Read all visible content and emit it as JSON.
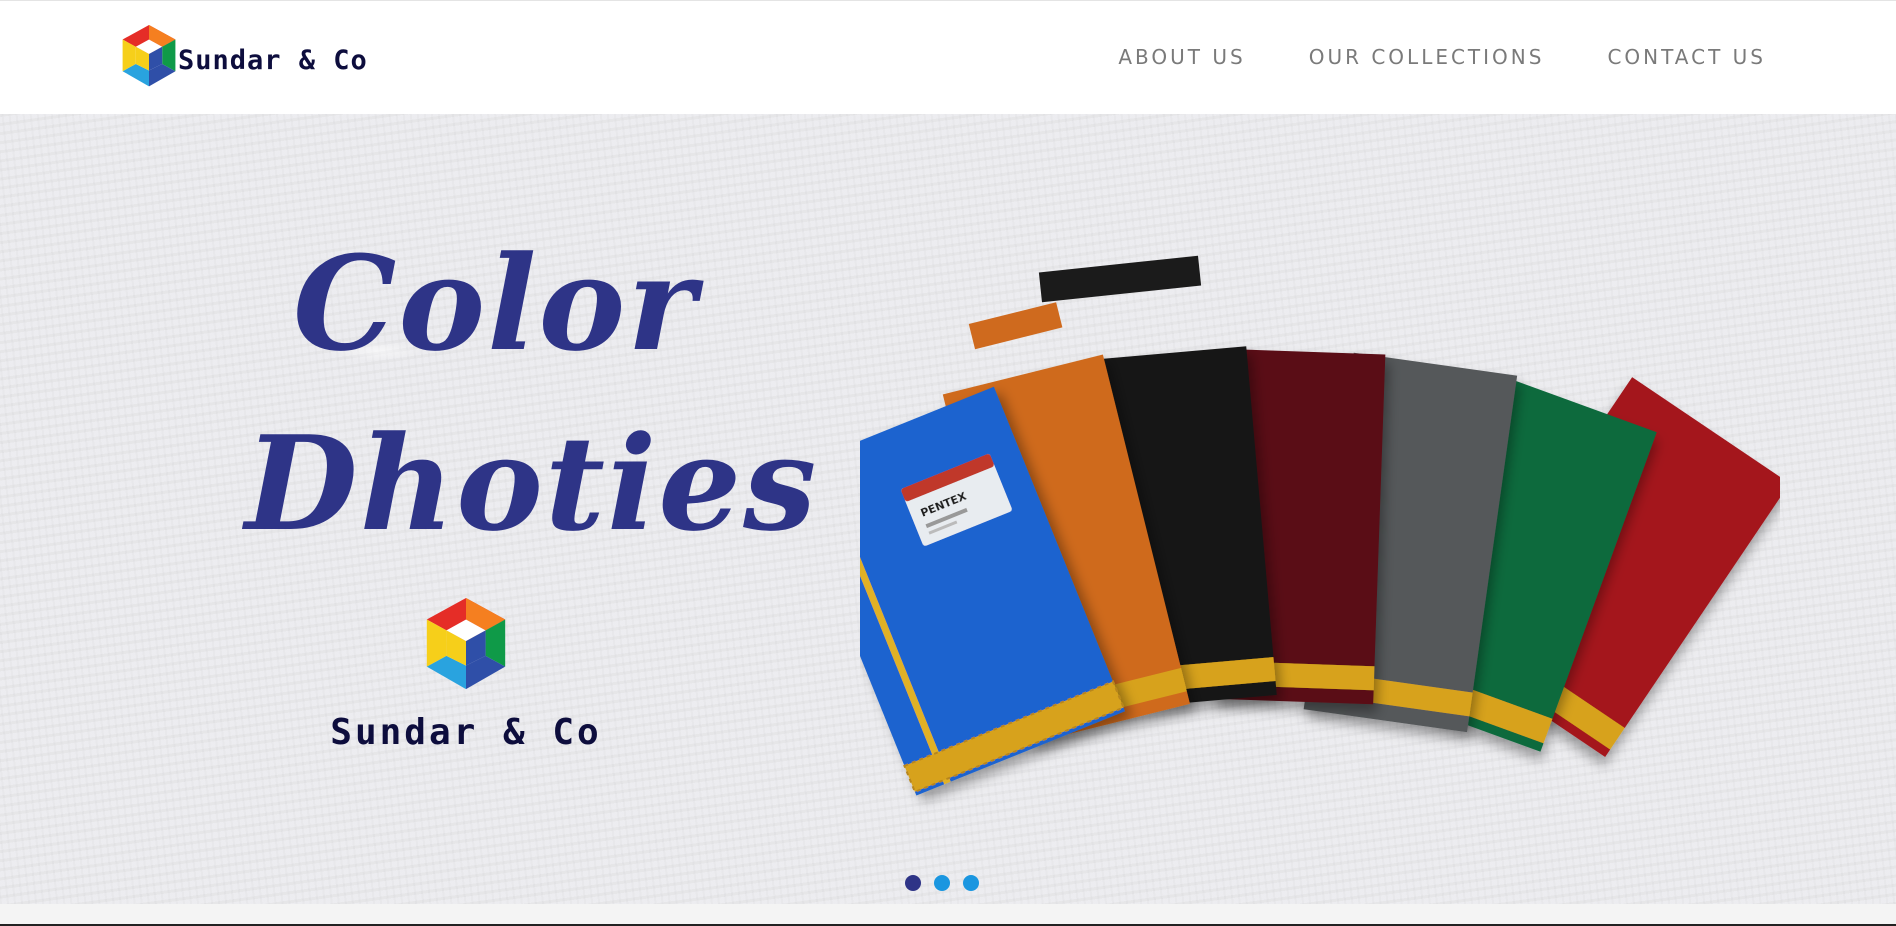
{
  "brand": {
    "name": "Sundar & Co",
    "logo_icon": "hexagon-cube-logo",
    "logo_colors": [
      "#e52d27",
      "#f57f20",
      "#0f9a48",
      "#2f4fa8",
      "#29a3df",
      "#f6cf1a"
    ]
  },
  "nav": {
    "items": [
      {
        "label": "ABOUT US"
      },
      {
        "label": "OUR COLLECTIONS"
      },
      {
        "label": "CONTACT US"
      }
    ]
  },
  "hero": {
    "title_line1": "Color",
    "title_line2": "Dhoties",
    "brand_name": "Sundar & Co",
    "product_tag": "PENTEX",
    "product_image": "fanned-color-dhoties",
    "dhoti_colors": [
      "#1c63cf",
      "#cf6a1e",
      "#141414",
      "#5a1119",
      "#55585a",
      "#0d6a3d",
      "#a4161a"
    ],
    "accent_color": "#2e3487"
  },
  "carousel": {
    "slides": 3,
    "active_index": 0,
    "active_color": "#2e3487",
    "inactive_color": "#1a96e0"
  }
}
